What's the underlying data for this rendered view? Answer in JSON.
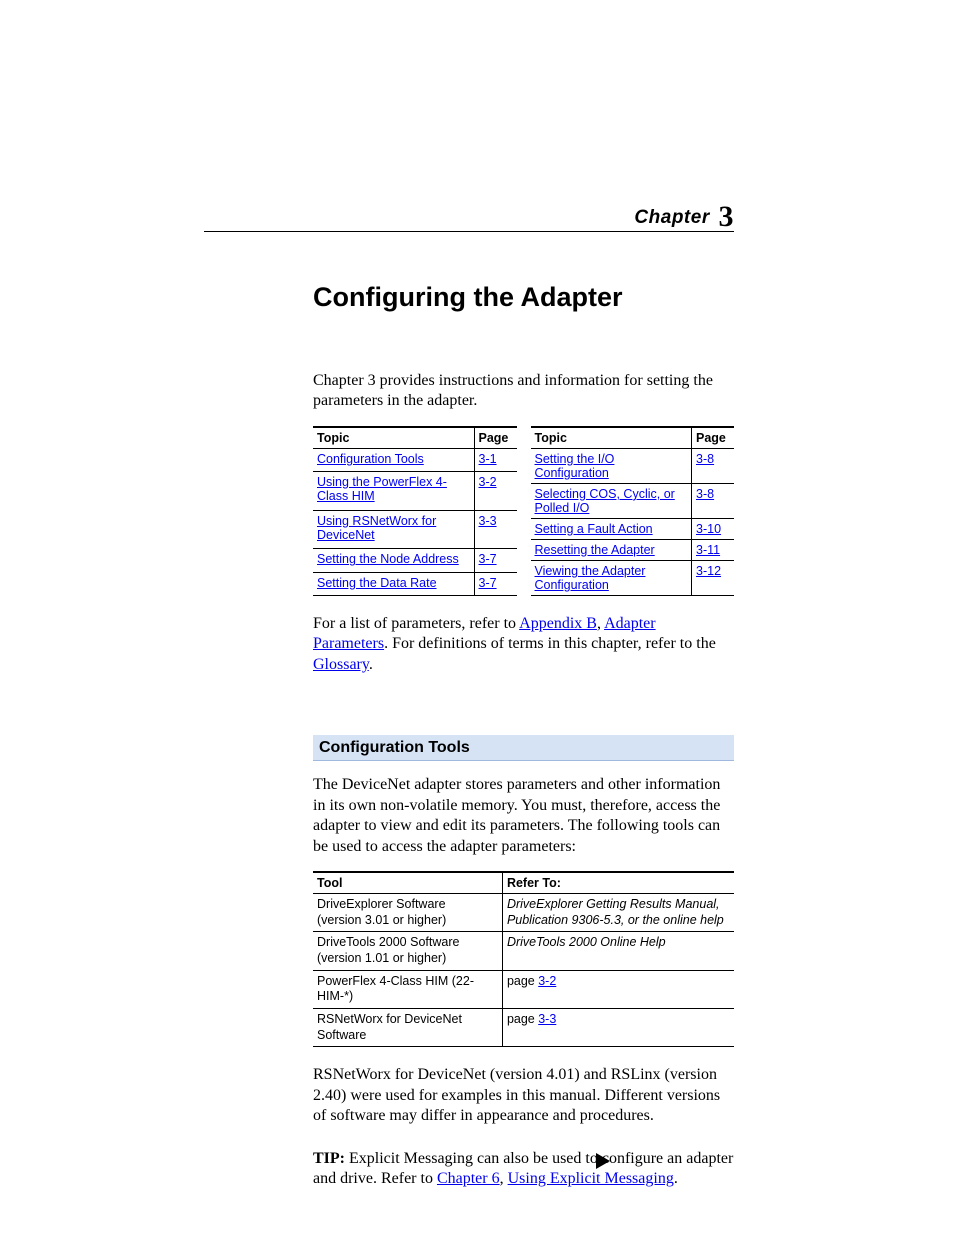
{
  "chapter": {
    "label": "Chapter",
    "number": "3"
  },
  "title": "Configuring the Adapter",
  "intro": "Chapter 3 provides instructions and information for setting the parameters in the adapter.",
  "topic_table": {
    "headers": {
      "topic": "Topic",
      "page": "Page"
    },
    "left": [
      {
        "topic": "Configuration Tools",
        "page": "3-1"
      },
      {
        "topic": "Using the PowerFlex 4-Class HIM",
        "page": "3-2"
      },
      {
        "topic": "Using RSNetWorx for DeviceNet",
        "page": "3-3"
      },
      {
        "topic": "Setting the Node Address",
        "page": "3-7"
      },
      {
        "topic": "Setting the Data Rate",
        "page": "3-7"
      }
    ],
    "right": [
      {
        "topic": "Setting the I/O Configuration",
        "page": "3-8"
      },
      {
        "topic": "Selecting COS, Cyclic, or Polled I/O",
        "page": "3-8"
      },
      {
        "topic": "Setting a Fault Action",
        "page": "3-10"
      },
      {
        "topic": "Resetting the Adapter",
        "page": "3-11"
      },
      {
        "topic": "Viewing the Adapter Configuration",
        "page": "3-12"
      }
    ]
  },
  "ref_para": {
    "pre": "For a list of parameters, refer to ",
    "link1": "Appendix B",
    "mid1": ", ",
    "link2": "Adapter Parameters",
    "mid2": ". For definitions of terms in this chapter, refer to the ",
    "link3": "Glossary",
    "post": "."
  },
  "section_heading": "Configuration Tools",
  "section_intro": "The DeviceNet adapter stores parameters and other information in its own non-volatile memory. You must, therefore, access the adapter to view and edit its parameters. The following tools can be used to access the adapter parameters:",
  "tools_table": {
    "headers": {
      "tool": "Tool",
      "refer": "Refer To:"
    },
    "rows": [
      {
        "tool": "DriveExplorer Software\n(version 3.01 or higher)",
        "refer": "DriveExplorer Getting Results Manual, Publication 9306-5.3, or the online help",
        "italic": true,
        "link": ""
      },
      {
        "tool": "DriveTools 2000 Software\n(version 1.01 or higher)",
        "refer": "DriveTools 2000 Online Help",
        "italic": true,
        "link": ""
      },
      {
        "tool": "PowerFlex 4-Class HIM (22-HIM-*)",
        "refer": "page ",
        "italic": false,
        "link": "3-2"
      },
      {
        "tool": "RSNetWorx for DeviceNet Software",
        "refer": "page ",
        "italic": false,
        "link": "3-3"
      }
    ]
  },
  "version_note": "RSNetWorx for DeviceNet (version 4.01) and RSLinx (version 2.40) were used for examples in this manual. Different versions of software may differ in appearance and procedures.",
  "tip": {
    "label": "TIP:",
    "text": "  Explicit Messaging can also be used to configure an adapter and drive. Refer to ",
    "link1": "Chapter 6",
    "mid": ", ",
    "link2": "Using Explicit Messaging",
    "post": "."
  }
}
